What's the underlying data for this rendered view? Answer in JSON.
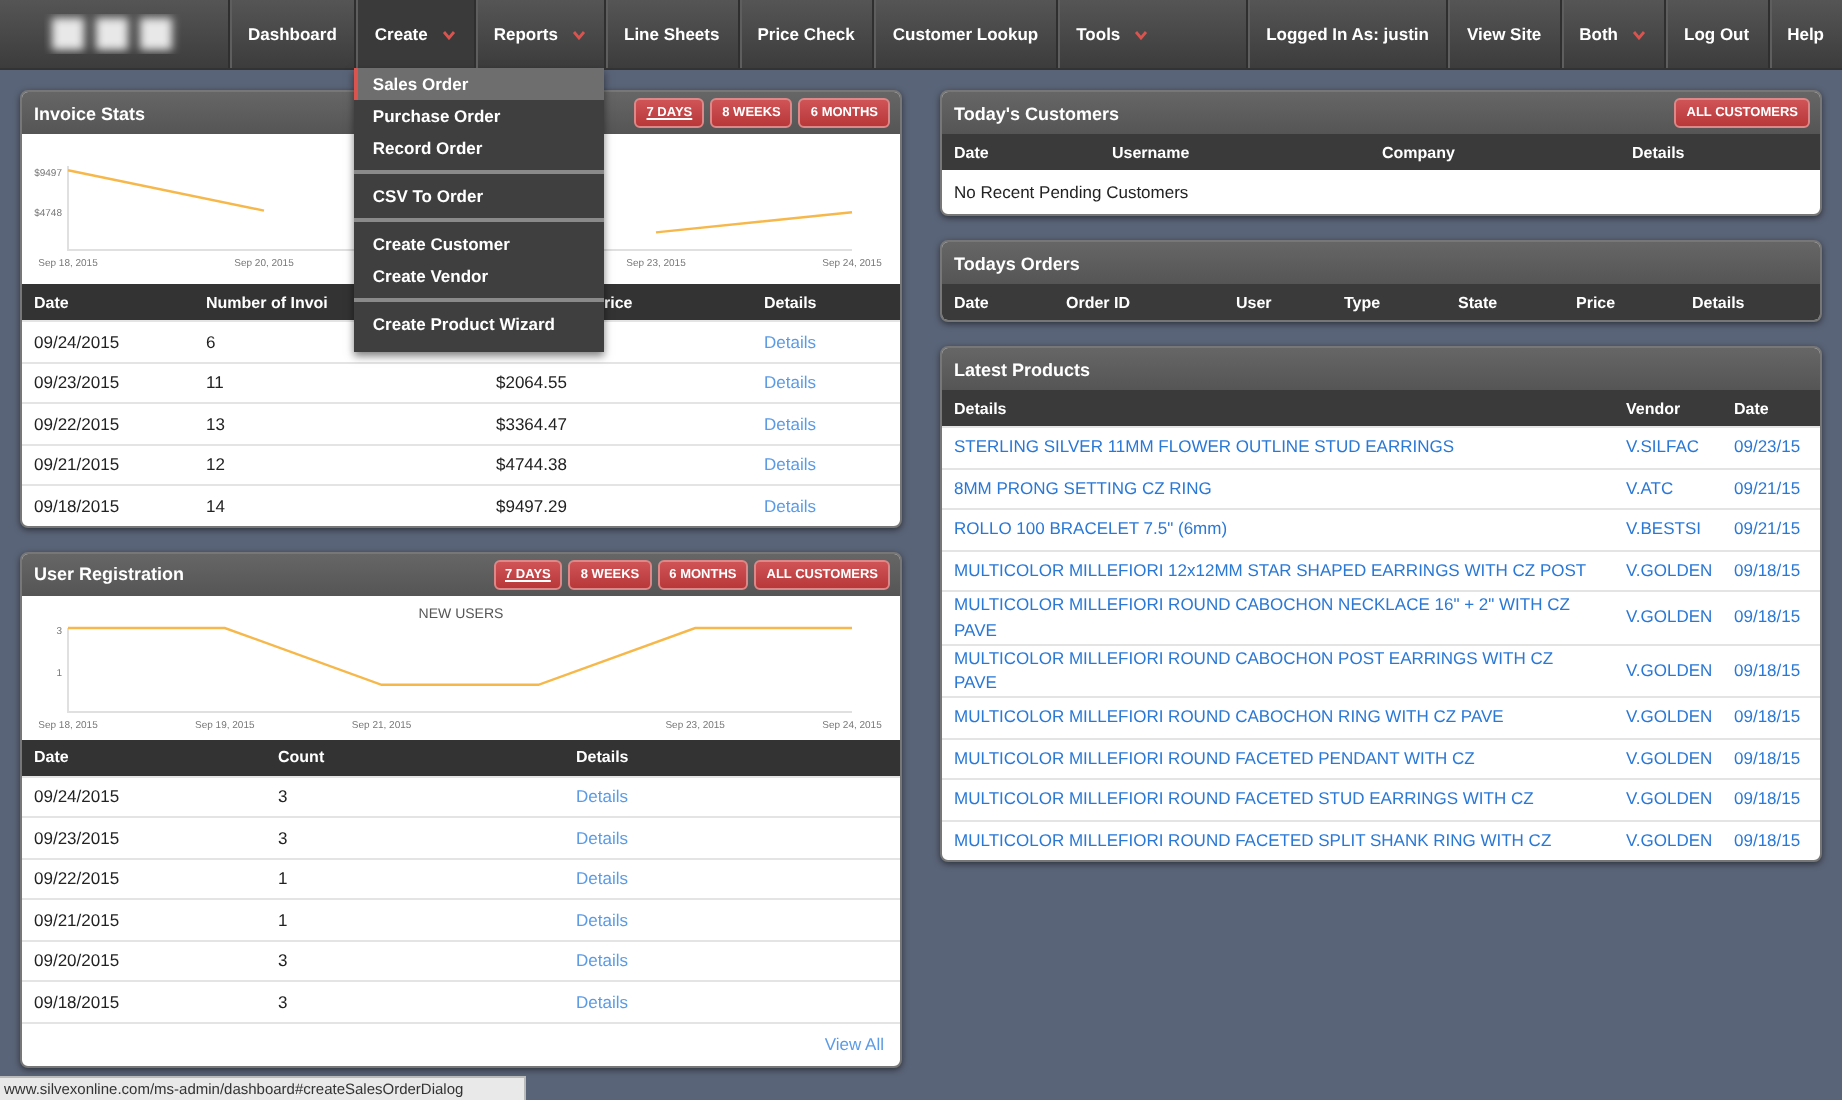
{
  "nav": {
    "items": [
      {
        "label": "Dashboard",
        "has_menu": false,
        "selected": false
      },
      {
        "label": "Create",
        "has_menu": true,
        "selected": true
      },
      {
        "label": "Reports",
        "has_menu": true,
        "selected": false
      },
      {
        "label": "Line Sheets",
        "has_menu": false,
        "selected": false
      },
      {
        "label": "Price Check",
        "has_menu": false,
        "selected": false
      },
      {
        "label": "Customer Lookup",
        "has_menu": false,
        "selected": false
      },
      {
        "label": "Tools",
        "has_menu": true,
        "selected": false
      }
    ],
    "user_items": [
      {
        "label": "Logged In As: justin",
        "has_menu": false,
        "selected": false
      },
      {
        "label": "View Site",
        "has_menu": false,
        "selected": false
      },
      {
        "label": "Both",
        "has_menu": true,
        "selected": false
      },
      {
        "label": "Log Out",
        "has_menu": false,
        "selected": false
      },
      {
        "label": "Help",
        "has_menu": false,
        "selected": false
      }
    ]
  },
  "create_menu": {
    "groups": [
      {
        "items": [
          {
            "label": "Sales Order",
            "selected": true
          },
          {
            "label": "Purchase Order",
            "selected": false
          },
          {
            "label": "Record Order",
            "selected": false
          }
        ]
      },
      {
        "items": [
          {
            "label": "CSV To Order",
            "selected": false
          }
        ]
      },
      {
        "items": [
          {
            "label": "Create Customer",
            "selected": false
          },
          {
            "label": "Create Vendor",
            "selected": false
          }
        ]
      },
      {
        "items": [
          {
            "label": "Create Product Wizard",
            "selected": false
          }
        ]
      }
    ]
  },
  "left": [
    {
      "title": "Invoice Stats",
      "buttons": [
        {
          "label": "7 DAYS",
          "selected": true
        },
        {
          "label": "8 WEEKS",
          "selected": false
        },
        {
          "label": "6 MONTHS",
          "selected": false
        }
      ],
      "chart_data": {
        "type": "line",
        "categories": [
          "Sep 18, 2015",
          "Sep 20, 2015",
          null,
          "Sep 23, 2015",
          "Sep 24, 2015"
        ],
        "ylim": [
          0,
          10000
        ],
        "yticks": [
          {
            "value": 4748,
            "label": "$4748"
          },
          {
            "value": 9497,
            "label": "$9497"
          }
        ],
        "series": [
          {
            "color": "#f7b84b",
            "values": [
              9500,
              4700,
              null,
              2100,
              4500
            ]
          }
        ]
      },
      "table": {
        "columns": [
          {
            "label": "Date",
            "kind": "text"
          },
          {
            "label": "Number of Invoi",
            "kind": "text"
          },
          {
            "label": "rice",
            "kind": "text"
          },
          {
            "label": "Details",
            "kind": "link"
          }
        ],
        "rows": [
          [
            "09/24/2015",
            "6",
            null,
            "Details"
          ],
          [
            "09/23/2015",
            "11",
            "$2064.55",
            "Details"
          ],
          [
            "09/22/2015",
            "13",
            "$3364.47",
            "Details"
          ],
          [
            "09/21/2015",
            "12",
            "$4744.38",
            "Details"
          ],
          [
            "09/18/2015",
            "14",
            "$9497.29",
            "Details"
          ]
        ]
      }
    },
    {
      "title": "User Registration",
      "buttons": [
        {
          "label": "7 DAYS",
          "selected": true
        },
        {
          "label": "8 WEEKS",
          "selected": false
        },
        {
          "label": "6 MONTHS",
          "selected": false
        },
        {
          "label": "ALL CUSTOMERS",
          "selected": false
        }
      ],
      "chart_data": {
        "type": "line",
        "title": "NEW USERS",
        "categories": [
          "Sep 18, 2015",
          "Sep 19, 2015",
          "Sep 21, 2015",
          null,
          "Sep 23, 2015",
          "Sep 24, 2015"
        ],
        "ylim": [
          -1,
          3
        ],
        "yticks": [
          1,
          3
        ],
        "series": [
          {
            "color": "#f7b84b",
            "values": [
              3,
              3,
              0.3,
              0.3,
              3,
              3
            ]
          }
        ]
      },
      "table": {
        "columns": [
          {
            "label": "Date",
            "kind": "text"
          },
          {
            "label": "Count",
            "kind": "text"
          },
          {
            "label": "Details",
            "kind": "link"
          }
        ],
        "rows": [
          [
            "09/24/2015",
            "3",
            "Details"
          ],
          [
            "09/23/2015",
            "3",
            "Details"
          ],
          [
            "09/22/2015",
            "1",
            "Details"
          ],
          [
            "09/21/2015",
            "1",
            "Details"
          ],
          [
            "09/20/2015",
            "3",
            "Details"
          ],
          [
            "09/18/2015",
            "3",
            "Details"
          ]
        ]
      },
      "footer_link": "View All"
    }
  ],
  "right": [
    {
      "title": "Today's Customers",
      "buttons": [
        {
          "label": "ALL CUSTOMERS",
          "selected": false
        }
      ],
      "table": {
        "columns": [
          {
            "label": "Date"
          },
          {
            "label": "Username"
          },
          {
            "label": "Company"
          },
          {
            "label": "Details"
          }
        ],
        "empty_message": "No Recent Pending Customers"
      }
    },
    {
      "title": "Todays Orders",
      "table": {
        "columns": [
          {
            "label": "Date"
          },
          {
            "label": "Order ID"
          },
          {
            "label": "User"
          },
          {
            "label": "Type"
          },
          {
            "label": "State"
          },
          {
            "label": "Price"
          },
          {
            "label": "Details"
          }
        ]
      }
    },
    {
      "title": "Latest Products",
      "table": {
        "columns": [
          {
            "label": "Details",
            "kind": "link"
          },
          {
            "label": "Vendor",
            "kind": "link"
          },
          {
            "label": "Date",
            "kind": "link"
          }
        ],
        "rows": [
          [
            "STERLING SILVER 11MM FLOWER OUTLINE STUD EARRINGS",
            "V.SILFAC",
            "09/23/15"
          ],
          [
            "8MM PRONG SETTING CZ RING",
            "V.ATC",
            "09/21/15"
          ],
          [
            "ROLLO 100 BRACELET 7.5\" (6mm)",
            "V.BESTSI",
            "09/21/15"
          ],
          [
            "MULTICOLOR MILLEFIORI 12x12MM STAR SHAPED EARRINGS WITH CZ POST",
            "V.GOLDEN",
            "09/18/15"
          ],
          [
            "MULTICOLOR MILLEFIORI ROUND CABOCHON NECKLACE 16\" + 2\" WITH CZ PAVE",
            "V.GOLDEN",
            "09/18/15"
          ],
          [
            "MULTICOLOR MILLEFIORI ROUND CABOCHON POST EARRINGS WITH CZ PAVE",
            "V.GOLDEN",
            "09/18/15"
          ],
          [
            "MULTICOLOR MILLEFIORI ROUND CABOCHON RING WITH CZ PAVE",
            "V.GOLDEN",
            "09/18/15"
          ],
          [
            "MULTICOLOR MILLEFIORI ROUND FACETED PENDANT WITH CZ",
            "V.GOLDEN",
            "09/18/15"
          ],
          [
            "MULTICOLOR MILLEFIORI ROUND FACETED STUD EARRINGS WITH CZ",
            "V.GOLDEN",
            "09/18/15"
          ],
          [
            "MULTICOLOR MILLEFIORI ROUND FACETED SPLIT SHANK RING WITH CZ",
            "V.GOLDEN",
            "09/18/15"
          ]
        ]
      }
    }
  ],
  "status_bar": {
    "url": "www.silvexonline.com/ms-admin/dashboard#createSalesOrderDialog"
  }
}
